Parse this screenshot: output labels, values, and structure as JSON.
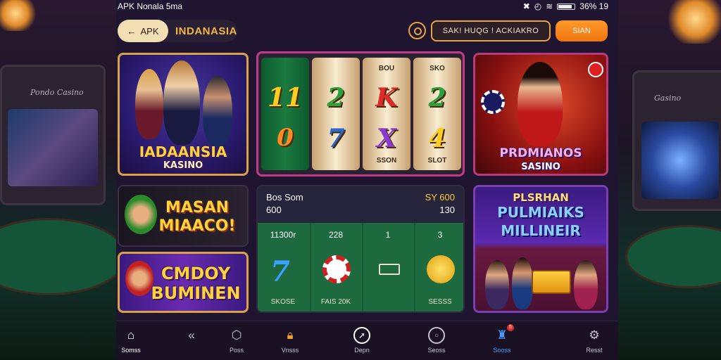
{
  "status_bar": {
    "left_text": "APK Nonala 5ma",
    "right_text": "36% 19"
  },
  "header": {
    "back_label": "APK",
    "brand": "INDANASIA",
    "search_text": "SAK! HUQG ! ACKIAKRO",
    "signin_label": "SIAN"
  },
  "cards": {
    "indanasia": {
      "title": "IADAANSIA",
      "subtitle": "KASINO"
    },
    "slots": {
      "reels": [
        {
          "top_label": "",
          "top": "11",
          "bottom": "0",
          "bottom_label": ""
        },
        {
          "top_label": "",
          "top": "2",
          "bottom": "7",
          "bottom_label": ""
        },
        {
          "top_label": "BOU",
          "top": "K",
          "bottom": "X",
          "bottom_label": "SSON"
        },
        {
          "top_label": "SKO",
          "top": "2",
          "bottom": "4",
          "bottom_label": "SLOT"
        }
      ]
    },
    "prdmianos": {
      "title": "PRDMIANOS",
      "subtitle": "SASINO"
    },
    "masan": {
      "title_line1": "MASAN",
      "title_line2": "MIAACO!"
    },
    "cmdoy": {
      "title_line1": "CMDOY",
      "title_line2": "BUMINEN"
    },
    "table": {
      "head_left_1": "Bos Som",
      "head_left_2": "600",
      "head_right_1": "SY 600",
      "head_right_2": "130",
      "columns": [
        {
          "value": "11300r",
          "bottom": "SKOSE"
        },
        {
          "value": "228",
          "bottom": "FAIS 20K"
        },
        {
          "value": "1",
          "bottom": ""
        },
        {
          "value": "3",
          "bottom": "SESSS"
        }
      ]
    },
    "pulmiaiks": {
      "title_line1": "PLSRHAN",
      "title_line2": "PULMIAIKS",
      "title_line3": "MILLINEIR"
    }
  },
  "nav": [
    {
      "label": "Somss",
      "icon": "home-icon"
    },
    {
      "label": "",
      "icon": "back-chevron-icon"
    },
    {
      "label": "Poss",
      "icon": "hexagon-icon"
    },
    {
      "label": "Vnsss",
      "icon": "lock-icon"
    },
    {
      "label": "Depn",
      "icon": "compass-icon"
    },
    {
      "label": "Seoss",
      "icon": "chat-icon"
    },
    {
      "label": "Sooss",
      "icon": "bell-icon",
      "badge": "5"
    },
    {
      "label": "Resst",
      "icon": "gear-icon"
    }
  ],
  "colors": {
    "accent": "#f07410",
    "gold": "#d9a14a",
    "felt": "#1c6a3e"
  }
}
